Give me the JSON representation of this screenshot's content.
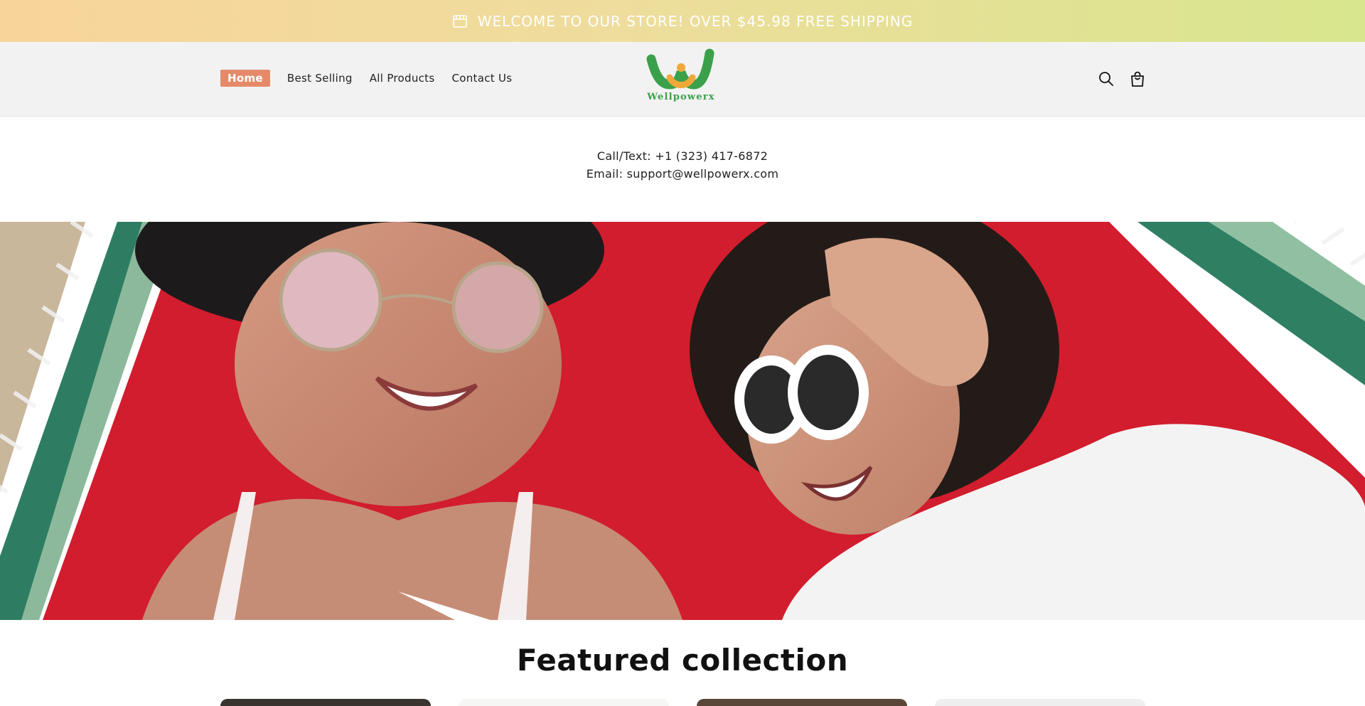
{
  "announcement": {
    "text": "WELCOME TO OUR STORE! OVER $45.98 FREE SHIPPING",
    "icon": "store-icon"
  },
  "header": {
    "nav": [
      {
        "label": "Home",
        "active": true
      },
      {
        "label": "Best Selling",
        "active": false
      },
      {
        "label": "All Products",
        "active": false
      },
      {
        "label": "Contact Us",
        "active": false
      }
    ],
    "logo_text": "Wellpowerx",
    "icons": [
      "search-icon",
      "cart-icon"
    ]
  },
  "contact": {
    "phone": "Call/Text: +1 (323) 417-6872",
    "email": "Email: support@wellpowerx.com"
  },
  "featured": {
    "title": "Featured collection"
  },
  "colors": {
    "announcement_gradient_start": "#f8d49b",
    "announcement_gradient_end": "#d8e68d",
    "nav_active_bg": "#e58a69",
    "logo_green": "#3aa14a",
    "logo_orange": "#f0a83a",
    "header_bg": "#f2f2f2"
  }
}
